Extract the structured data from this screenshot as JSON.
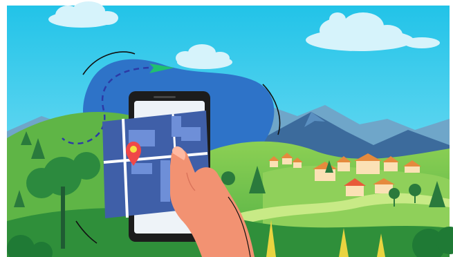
{
  "scene": {
    "title": "",
    "elements": {
      "sky": "sky",
      "clouds": [
        "cloud-left",
        "cloud-top-center",
        "cloud-right"
      ],
      "paper_plane": "paper-plane-icon",
      "flight_path": "dashed-flight-path",
      "mountains": [
        "mountain-range-back",
        "mountain-range-front"
      ],
      "village": "village-houses",
      "phone": "smartphone",
      "map": "map-card",
      "location_pin": "location-pin-icon",
      "hand": "hand"
    }
  },
  "colors": {
    "sky_top": "#22c3e8",
    "sky_bottom": "#7ee0f6",
    "blob": "#2e73c8",
    "mountain": "#3f6fa0",
    "hill_light": "#a3d65a",
    "hill_mid": "#5fba4d",
    "hill_dark": "#2f8f3a",
    "phone_frame": "#1c1c1c",
    "map_bg": "#3f5fa8",
    "pin": "#f04848",
    "skin": "#f29272",
    "roof": "#e58a3d",
    "wall": "#fbe1b5"
  }
}
